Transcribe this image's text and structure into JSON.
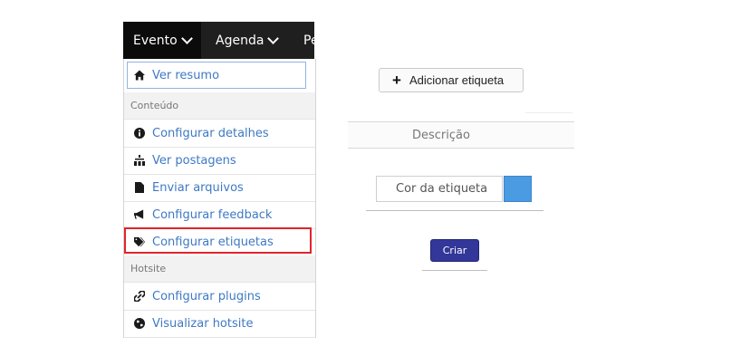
{
  "nav": {
    "items": [
      {
        "label": "Evento"
      },
      {
        "label": "Agenda"
      },
      {
        "label": "Pe"
      }
    ]
  },
  "menu": {
    "view_summary": "Ver resumo",
    "section_content": "Conteúdo",
    "items_content": [
      {
        "label": "Configurar detalhes",
        "icon": "info-circle-icon"
      },
      {
        "label": "Ver postagens",
        "icon": "sitemap-icon"
      },
      {
        "label": "Enviar arquivos",
        "icon": "file-icon"
      },
      {
        "label": "Configurar feedback",
        "icon": "bullhorn-icon"
      },
      {
        "label": "Configurar etiquetas",
        "icon": "tags-icon"
      }
    ],
    "section_hotsite": "Hotsite",
    "items_hotsite": [
      {
        "label": "Configurar plugins",
        "icon": "link-icon"
      },
      {
        "label": "Visualizar hotsite",
        "icon": "globe-icon"
      }
    ]
  },
  "form": {
    "add_label": "Adicionar etiqueta",
    "description_label": "Descrição",
    "color_label": "Cor da etiqueta",
    "color_value": "#4a9be2",
    "create_label": "Criar"
  }
}
